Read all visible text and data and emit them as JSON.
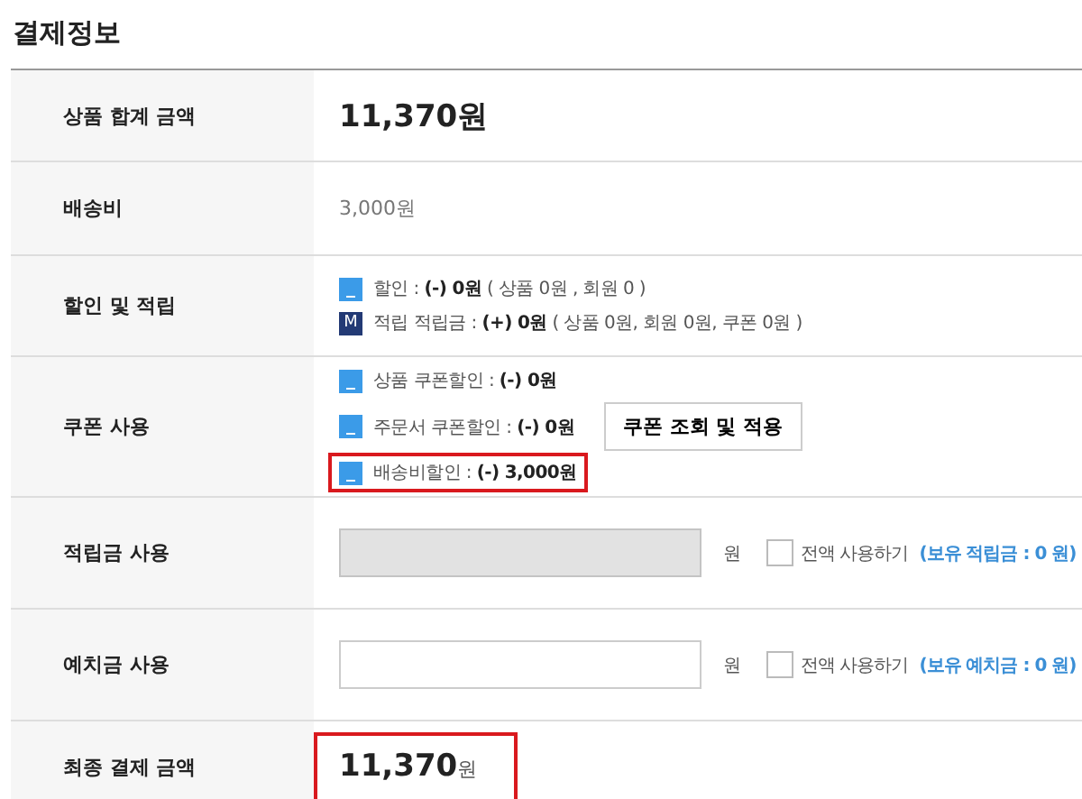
{
  "title": "결제정보",
  "rows": [
    {
      "kind": "amount",
      "label": "상품 합계 금액",
      "amount": "11,370원"
    },
    {
      "kind": "plain",
      "label": "배송비",
      "value": "3,000원"
    },
    {
      "kind": "lines",
      "label": "할인 및 적립",
      "lines": [
        {
          "kind": "minus",
          "text": "할인 : **(-) 0원** ( 상품 0원 , 회원 0 )",
          "highlighted": false
        },
        {
          "kind": "badge",
          "badge": "M",
          "text": "적립 적립금 : **(+) 0원** ( 상품 0원, 회원 0원, 쿠폰 0원 )",
          "highlighted": false
        }
      ]
    },
    {
      "kind": "coupon",
      "label": "쿠폰 사용",
      "lines": [
        {
          "kind": "minus",
          "text": "상품 쿠폰할인 : **(-) 0원**",
          "highlighted": false
        },
        {
          "kind": "minus",
          "text": "주문서 쿠폰할인 : **(-) 0원**",
          "highlighted": false,
          "button": "쿠폰 조회 및 적용"
        },
        {
          "kind": "minus",
          "text": "배송비할인 : **(-) 3,000원**",
          "highlighted": true
        }
      ]
    },
    {
      "kind": "input",
      "label": "적립금 사용",
      "disabled": true,
      "unit": "원",
      "checked": false,
      "check_label": "전액 사용하기",
      "link": "(보유 적립금 : 0 원)"
    },
    {
      "kind": "input",
      "label": "예치금 사용",
      "disabled": false,
      "unit": "원",
      "checked": false,
      "check_label": "전액 사용하기",
      "link": "(보유 예치금 : 0 원)"
    },
    {
      "kind": "total",
      "label": "최종 결제 금액",
      "amount": "11,370",
      "unit": "원",
      "highlighted": true
    }
  ]
}
